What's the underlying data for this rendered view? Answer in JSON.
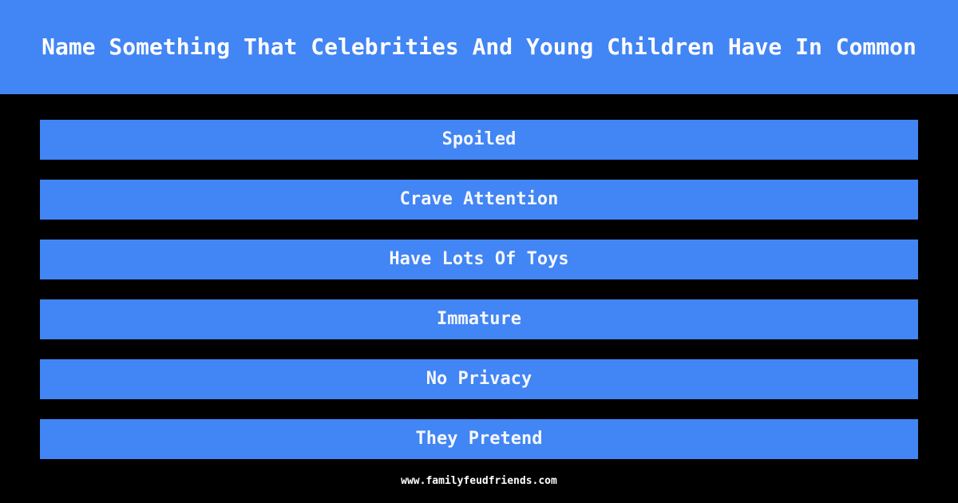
{
  "theme": {
    "background_color": "#000000",
    "accent_color": "#4285f4",
    "header_text_color": "#ffffff",
    "answer_text_color": "#f4f7fc",
    "footer_text_color": "#ffffff"
  },
  "header": {
    "question": "Name Something That Celebrities And Young Children Have In Common"
  },
  "answers": [
    {
      "rank": 1,
      "text": "Spoiled"
    },
    {
      "rank": 2,
      "text": "Crave Attention"
    },
    {
      "rank": 3,
      "text": "Have Lots Of Toys"
    },
    {
      "rank": 4,
      "text": "Immature"
    },
    {
      "rank": 5,
      "text": "No Privacy"
    },
    {
      "rank": 6,
      "text": "They Pretend"
    }
  ],
  "footer": {
    "website": "www.familyfeudfriends.com"
  }
}
